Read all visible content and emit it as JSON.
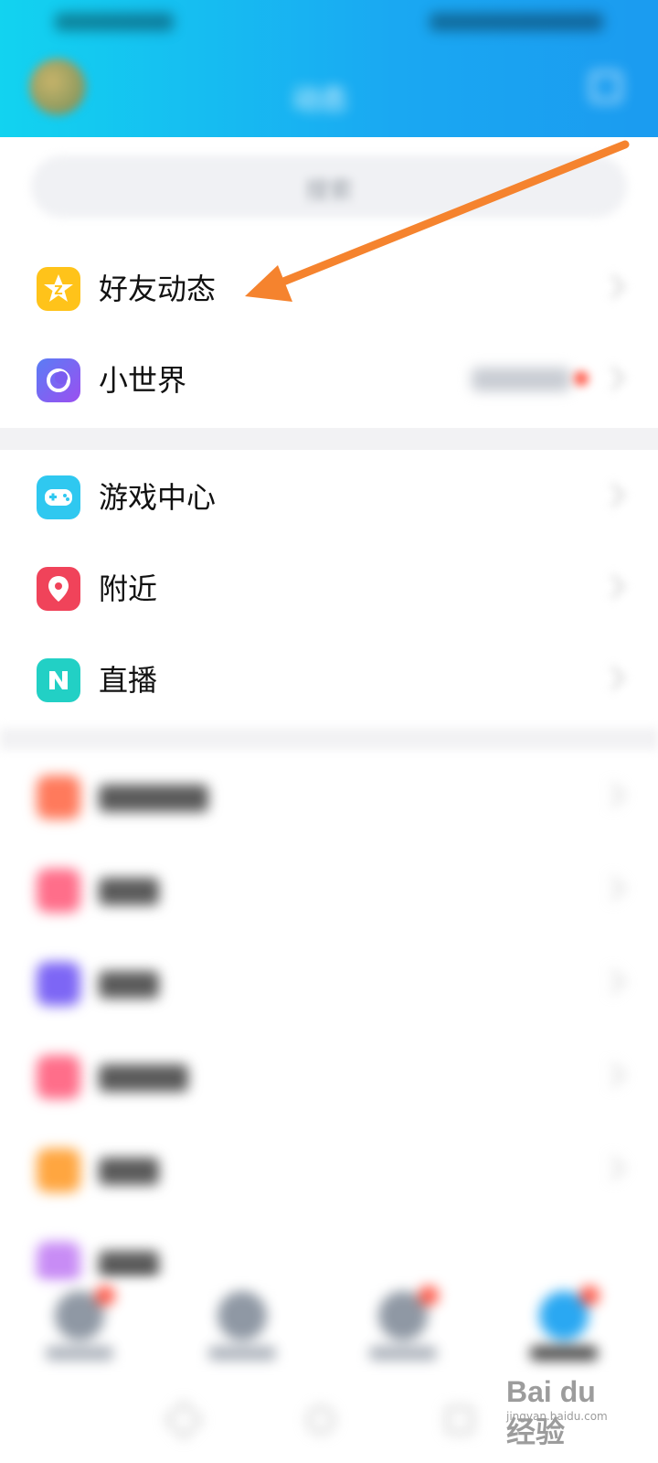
{
  "header": {
    "title": "动态",
    "avatar_icon": "avatar-icon",
    "edit_icon": "edit-icon"
  },
  "search": {
    "placeholder": "搜索"
  },
  "sections": [
    [
      {
        "label": "好友动态",
        "icon": "qzone-star-icon",
        "color": "#FFC31A"
      },
      {
        "label": "小世界",
        "icon": "planet-icon",
        "color": "#7B5CF0",
        "badge_text": "关注",
        "badge_dot": true
      }
    ],
    [
      {
        "label": "游戏中心",
        "icon": "gamepad-icon",
        "color": "#2FC8F0"
      },
      {
        "label": "附近",
        "icon": "location-pin-icon",
        "color": "#F0435A"
      },
      {
        "label": "直播",
        "icon": "live-n-icon",
        "color": "#22D0C5"
      }
    ]
  ],
  "blurred_items": [
    {
      "label": "",
      "color": "#FF7A5C"
    },
    {
      "label": "",
      "color": "#FF6E8A"
    },
    {
      "label": "",
      "color": "#7D66F5"
    },
    {
      "label": "",
      "color": "#FF6E8A"
    },
    {
      "label": "",
      "color": "#FFA640"
    },
    {
      "label": "",
      "color": "#C88CF5"
    }
  ],
  "arrow_color": "#F5832E",
  "watermark": {
    "brand": "Bai du 经验",
    "url": "jingyan.baidu.com"
  }
}
